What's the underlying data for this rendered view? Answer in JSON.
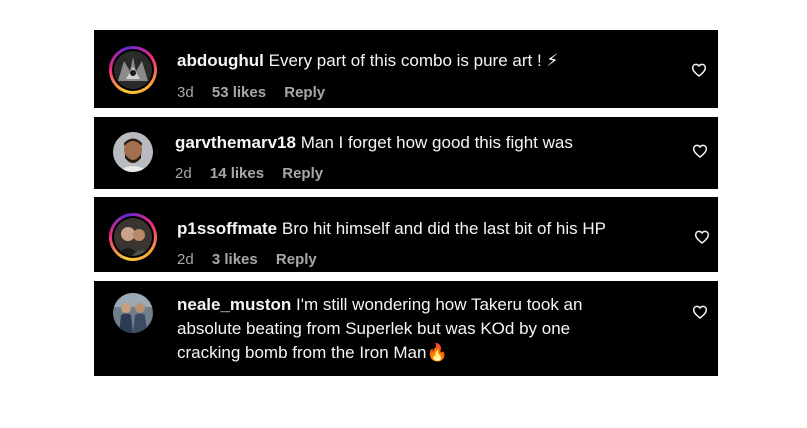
{
  "comments": [
    {
      "username": "abdoughul",
      "text": "Every part of this combo is pure art ! ⚡",
      "age": "3d",
      "likes": "53 likes",
      "reply": "Reply"
    },
    {
      "username": "garvthemarv18",
      "text": "Man I forget how good this fight was",
      "age": "2d",
      "likes": "14 likes",
      "reply": "Reply"
    },
    {
      "username": "p1ssoffmate",
      "text": "Bro hit himself and did the last bit of his HP",
      "age": "2d",
      "likes": "3 likes",
      "reply": "Reply"
    },
    {
      "username": "neale_muston",
      "text": "I'm still wondering how Takeru took an absolute beating from Superlek but was KOd by one cracking bomb from the Iron Man🔥",
      "age": "",
      "likes": "",
      "reply": ""
    }
  ],
  "icons": {
    "like": "heart-icon"
  }
}
